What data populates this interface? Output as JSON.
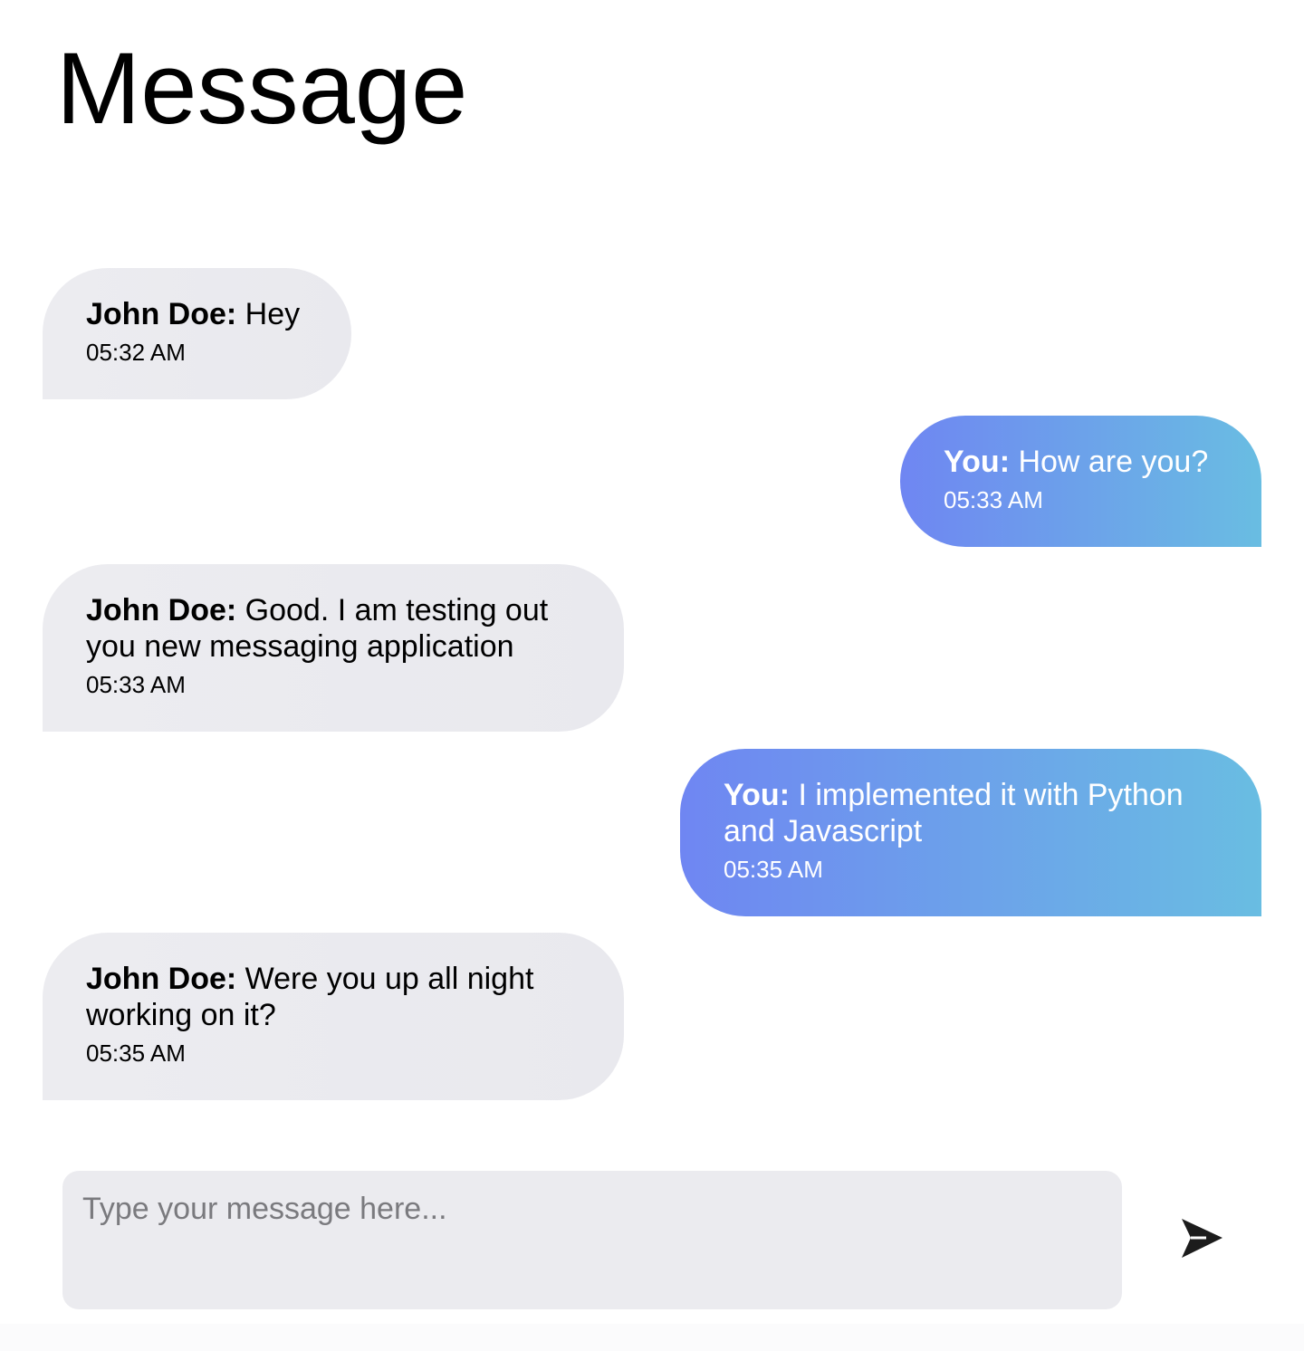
{
  "header": {
    "title": "Message"
  },
  "messages": [
    {
      "sender": "John Doe:",
      "text": " Hey",
      "time": "05:32 AM",
      "direction": "incoming"
    },
    {
      "sender": "You:",
      "text": " How are you?",
      "time": "05:33 AM",
      "direction": "outgoing"
    },
    {
      "sender": "John Doe:",
      "text": " Good. I am testing out you new messaging application",
      "time": "05:33 AM",
      "direction": "incoming"
    },
    {
      "sender": "You:",
      "text": " I implemented it with Python and Javascript",
      "time": "05:35 AM",
      "direction": "outgoing"
    },
    {
      "sender": "John Doe:",
      "text": " Were you up all night working on it?",
      "time": "05:35 AM",
      "direction": "incoming"
    }
  ],
  "composer": {
    "placeholder": "Type your message here...",
    "value": ""
  },
  "send_button": {
    "icon": "send-icon"
  },
  "colors": {
    "incoming_bubble": "#ebebef",
    "outgoing_gradient_start": "#6f86f2",
    "outgoing_gradient_end": "#69bde2",
    "composer_bg": "#ebebef"
  }
}
